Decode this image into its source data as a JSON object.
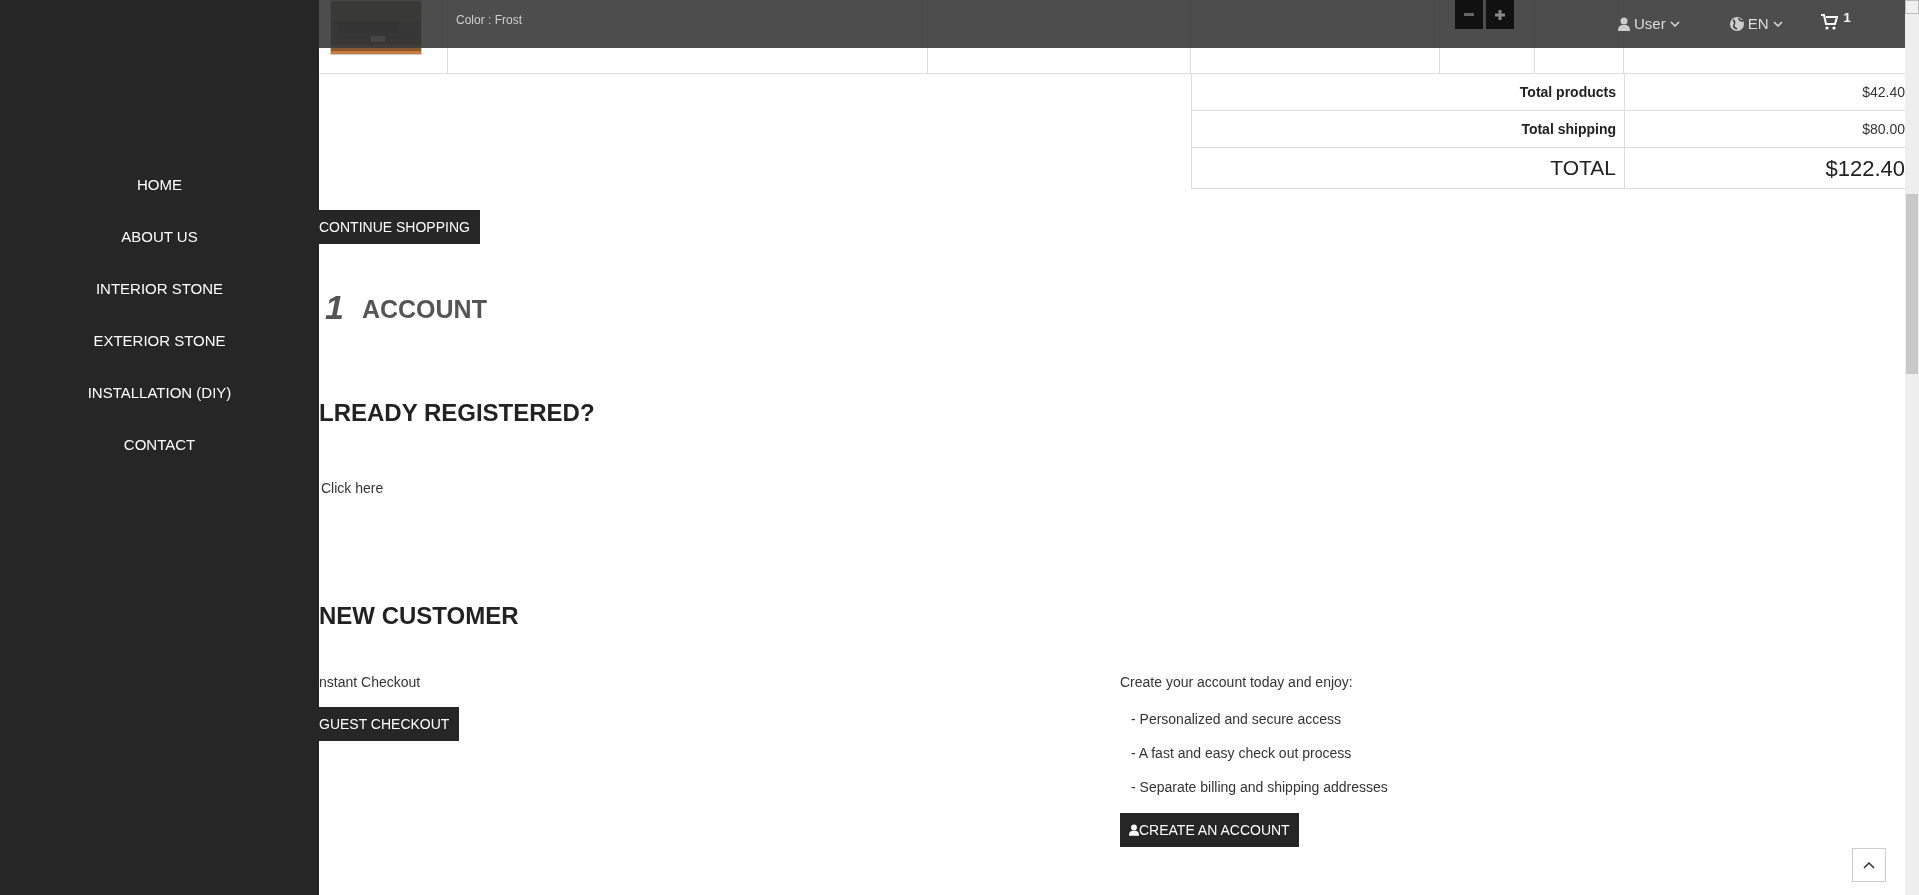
{
  "sidebar": {
    "items": [
      {
        "label": "HOME"
      },
      {
        "label": "ABOUT US"
      },
      {
        "label": "INTERIOR STONE"
      },
      {
        "label": "EXTERIOR STONE"
      },
      {
        "label": "INSTALLATION (DIY)"
      },
      {
        "label": "CONTACT"
      }
    ]
  },
  "header": {
    "user": "User",
    "language": "EN",
    "cart_count": "1"
  },
  "cart": {
    "product": {
      "attribute": "Color : Frost"
    },
    "totals": [
      {
        "kind": "subtotal",
        "label": "Total products",
        "value": "$42.40"
      },
      {
        "kind": "subtotal",
        "label": "Total shipping",
        "value": "$80.00"
      },
      {
        "kind": "grand",
        "label": "TOTAL",
        "value": "$122.40"
      }
    ]
  },
  "continue_button": "CONTINUE SHOPPING",
  "account_step": {
    "number": "1",
    "title": "ACCOUNT"
  },
  "registered": {
    "title": "LREADY REGISTERED?",
    "link": "Click here"
  },
  "new_customer": {
    "title": "NEW CUSTOMER",
    "left": {
      "text": "nstant Checkout",
      "button": "GUEST CHECKOUT"
    },
    "right": {
      "intro": "Create your account today and enjoy:",
      "benefits": [
        "- Personalized and secure access",
        "- A fast and easy check out process",
        "- Separate billing and shipping addresses"
      ],
      "button": "CREATE AN ACCOUNT"
    }
  }
}
